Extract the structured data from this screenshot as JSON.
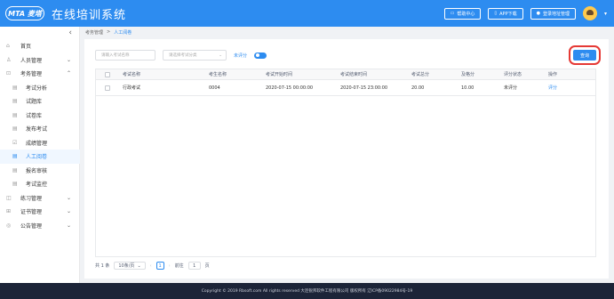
{
  "header": {
    "logo": "MTA 麦塔",
    "title": "在线培训系统",
    "buttons": [
      {
        "icon": "monitor-icon",
        "label": "帮助中心"
      },
      {
        "icon": "phone-icon",
        "label": "APP下载"
      },
      {
        "icon": "user-icon",
        "label": "登录地址管理"
      }
    ]
  },
  "sidebar": {
    "collapse_glyph": "‹",
    "items": [
      {
        "icon": "home-icon",
        "label": "首页",
        "arrow": ""
      },
      {
        "icon": "users-icon",
        "label": "人员管理",
        "arrow": "⌄"
      },
      {
        "icon": "exam-icon",
        "label": "考务管理",
        "arrow": "⌃"
      },
      {
        "icon": "chart-icon",
        "label": "考试分析",
        "arrow": "",
        "sub": true
      },
      {
        "icon": "bank-icon",
        "label": "试题库",
        "arrow": "",
        "sub": true
      },
      {
        "icon": "paper-icon",
        "label": "试卷库",
        "arrow": "",
        "sub": true
      },
      {
        "icon": "publish-icon",
        "label": "发布考试",
        "arrow": "",
        "sub": true
      },
      {
        "icon": "score-icon",
        "label": "成绩管理",
        "arrow": "",
        "sub": true
      },
      {
        "icon": "grade-icon",
        "label": "人工阅卷",
        "arrow": "",
        "sub": true,
        "active": true
      },
      {
        "icon": "review-icon",
        "label": "报名审核",
        "arrow": "",
        "sub": true
      },
      {
        "icon": "monitor-icon",
        "label": "考试监控",
        "arrow": "",
        "sub": true
      },
      {
        "icon": "practice-icon",
        "label": "练习管理",
        "arrow": "⌄"
      },
      {
        "icon": "cert-icon",
        "label": "证书管理",
        "arrow": "⌄"
      },
      {
        "icon": "notice-icon",
        "label": "公告管理",
        "arrow": "⌄"
      }
    ]
  },
  "breadcrumb": {
    "root": "考务管理",
    "sep": ">",
    "current": "人工阅卷"
  },
  "filters": {
    "exam_name_placeholder": "请输入考试名称",
    "exam_type_placeholder": "请选择考试分类",
    "toggle_label": "未评分",
    "query_label": "查询"
  },
  "table": {
    "headers": [
      "考试名称",
      "考生名称",
      "考试开始时间",
      "考试结束时间",
      "考试总分",
      "及格分",
      "评分状态",
      "操作"
    ],
    "rows": [
      [
        "行政考试",
        "0004",
        "2020-07-15 00:00:00",
        "2020-07-15 23:00:00",
        "20.00",
        "10.00",
        "未评分",
        "评分"
      ]
    ]
  },
  "pager": {
    "total": "共 1 条",
    "page_size": "10条/页",
    "prev": "‹",
    "current_page": "1",
    "next": "›",
    "goto_label": "前往",
    "goto_value": "1",
    "page_suffix": "页"
  },
  "footer": "Copyright © 2019 Rbsoft.com All rights reserved 大连锐邦软件工程有限公司 版权所有 辽ICP备09022984号-19",
  "colors": {
    "primary": "#2d8cf0",
    "highlight": "#e53935",
    "footer_bg": "#1c2438"
  }
}
